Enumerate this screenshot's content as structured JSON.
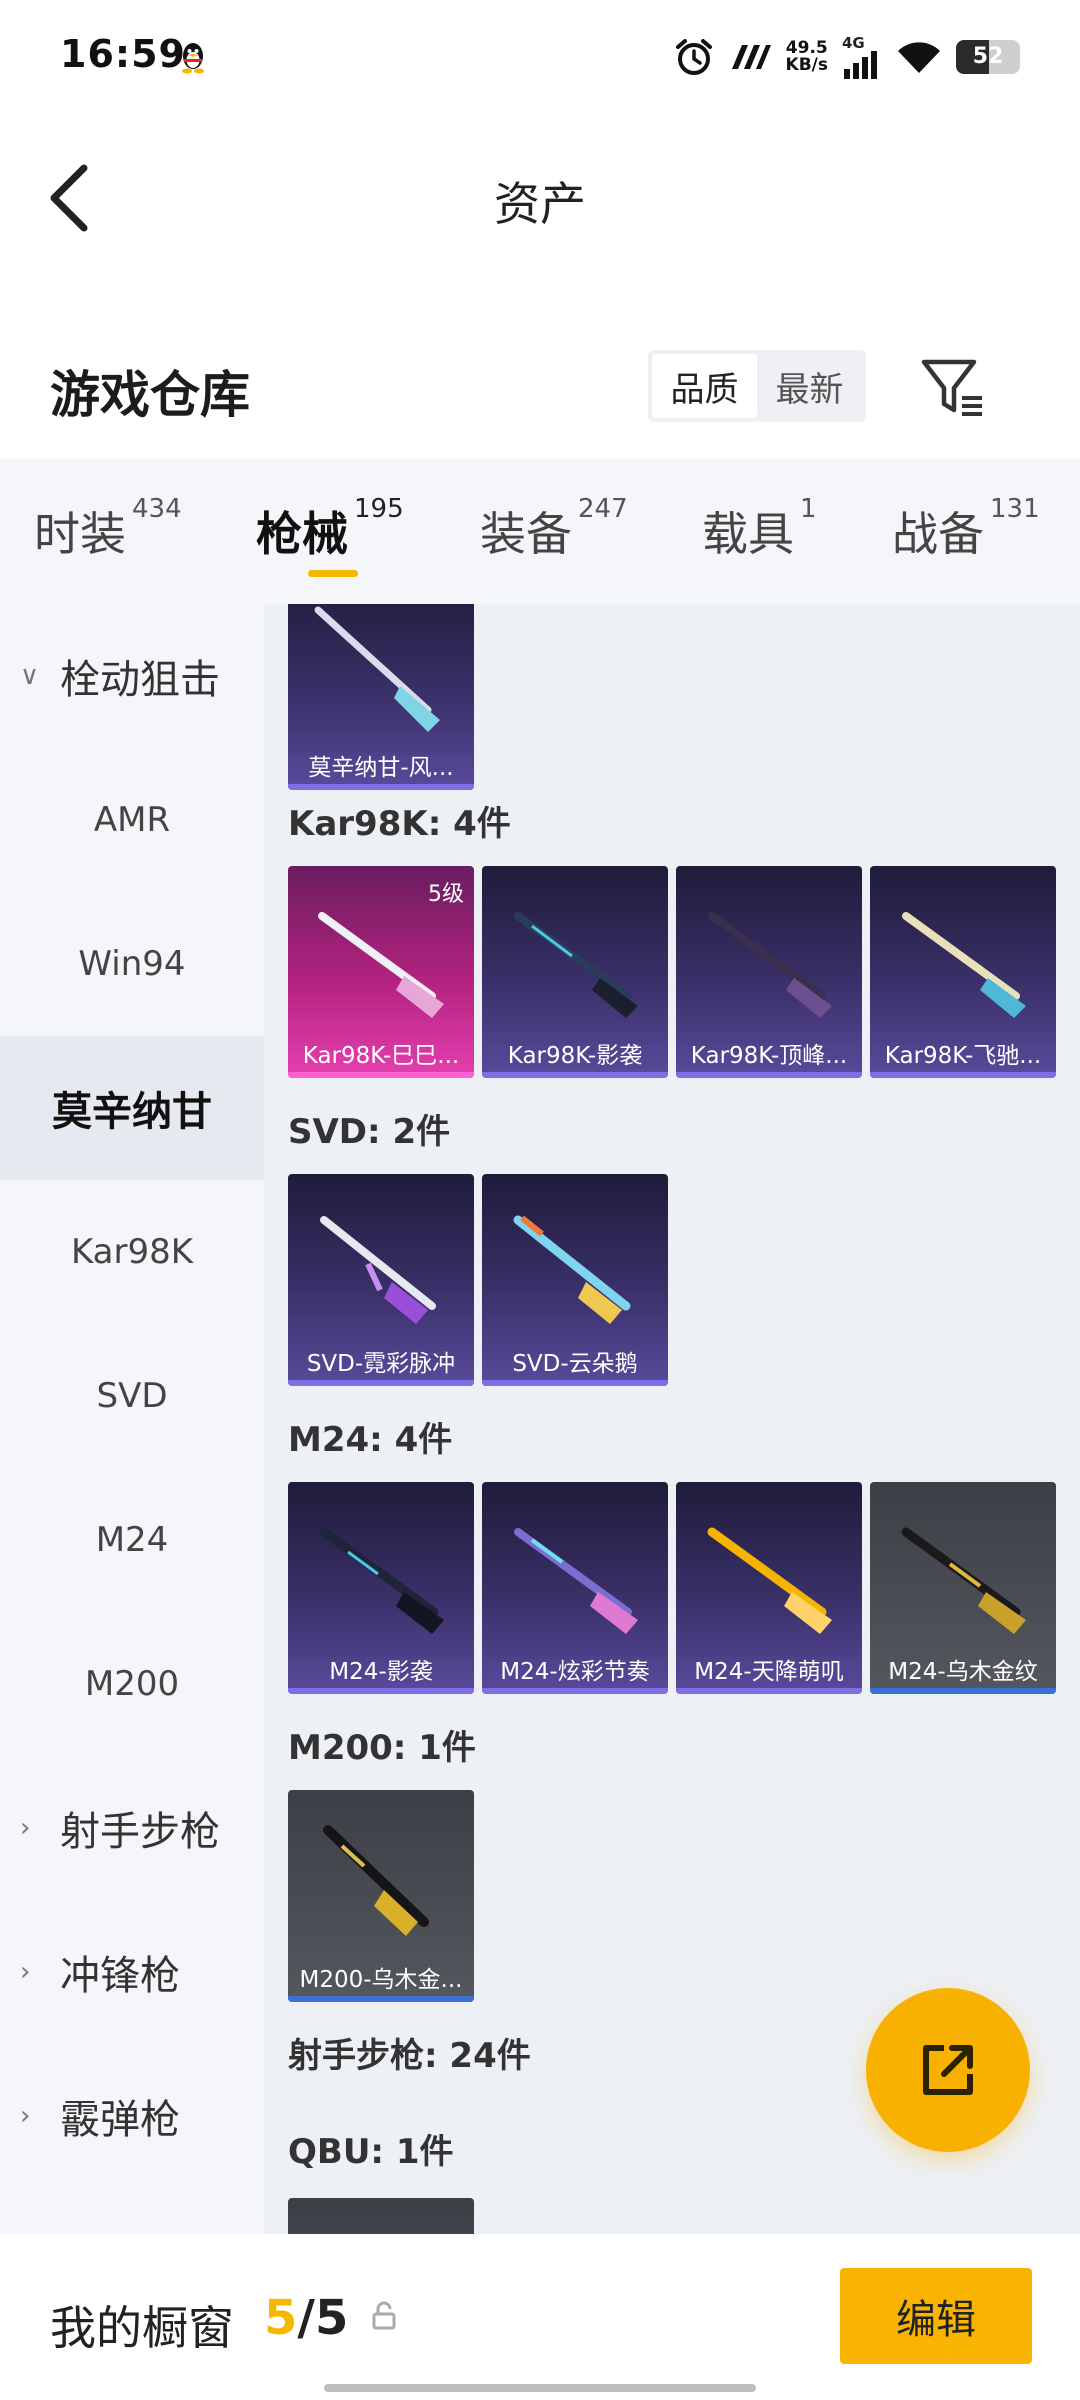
{
  "status_bar": {
    "time": "16:59",
    "speed_value": "49.5",
    "speed_unit": "KB/s",
    "network": "4G",
    "battery": "52",
    "battery_level": 0.52
  },
  "header": {
    "title": "资产"
  },
  "section": {
    "title": "游戏仓库",
    "sort_options": [
      "品质",
      "最新"
    ],
    "sort_selected": "品质"
  },
  "tabs": [
    {
      "label": "时装",
      "count": "434"
    },
    {
      "label": "枪械",
      "count": "195"
    },
    {
      "label": "装备",
      "count": "247"
    },
    {
      "label": "载具",
      "count": "1"
    },
    {
      "label": "战备",
      "count": "131"
    }
  ],
  "active_tab": "枪械",
  "sidebar": {
    "items": [
      {
        "label": "栓动狙击",
        "type": "group",
        "chevron": "∨"
      },
      {
        "label": "AMR",
        "type": "sub"
      },
      {
        "label": "Win94",
        "type": "sub"
      },
      {
        "label": "莫辛纳甘",
        "type": "sub",
        "active": true
      },
      {
        "label": "Kar98K",
        "type": "sub"
      },
      {
        "label": "SVD",
        "type": "sub"
      },
      {
        "label": "M24",
        "type": "sub"
      },
      {
        "label": "M200",
        "type": "sub"
      },
      {
        "label": "射手步枪",
        "type": "group",
        "chevron": "›"
      },
      {
        "label": "冲锋枪",
        "type": "group",
        "chevron": "›"
      },
      {
        "label": "霰弹枪",
        "type": "group",
        "chevron": "›"
      }
    ]
  },
  "content": {
    "groups": [
      {
        "label": "Kar98K: 4件"
      },
      {
        "label": "SVD: 2件"
      },
      {
        "label": "M24: 4件"
      },
      {
        "label": "M200: 1件"
      },
      {
        "label": "射手步枪: 24件"
      },
      {
        "label": "QBU: 1件"
      }
    ],
    "cards": [
      {
        "name": "莫辛纳甘-风...",
        "style": "purple"
      },
      {
        "name": "Kar98K-巳巳...",
        "style": "pink",
        "level": "5级"
      },
      {
        "name": "Kar98K-影袭",
        "style": "purple"
      },
      {
        "name": "Kar98K-顶峰...",
        "style": "purple"
      },
      {
        "name": "Kar98K-飞驰...",
        "style": "purple"
      },
      {
        "name": "SVD-霓彩脉冲",
        "style": "purple"
      },
      {
        "name": "SVD-云朵鹅",
        "style": "purple"
      },
      {
        "name": "M24-影袭",
        "style": "purple"
      },
      {
        "name": "M24-炫彩节奏",
        "style": "purple"
      },
      {
        "name": "M24-天降萌叽",
        "style": "purple"
      },
      {
        "name": "M24-乌木金纹",
        "style": "grey"
      },
      {
        "name": "M200-乌木金...",
        "style": "grey"
      }
    ]
  },
  "bottom_bar": {
    "label": "我的橱窗",
    "count_current": "5",
    "count_sep": "/",
    "count_total": "5",
    "edit_label": "编辑"
  },
  "colors": {
    "accent": "#F8B400",
    "tab_underline": "#F5B800",
    "card_purple": "#3A3069",
    "card_pink": "#B3237F",
    "card_grey": "#55575F"
  }
}
